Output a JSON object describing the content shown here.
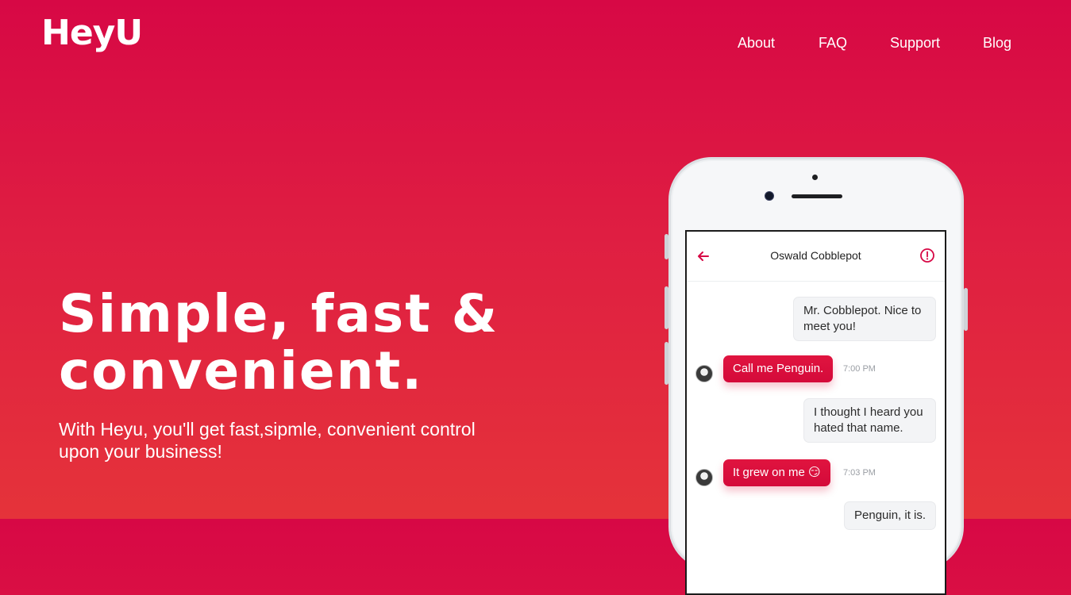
{
  "brand": {
    "logo": "HeyU"
  },
  "nav": {
    "items": [
      {
        "label": "About"
      },
      {
        "label": "FAQ"
      },
      {
        "label": "Support"
      },
      {
        "label": "Blog"
      }
    ]
  },
  "hero": {
    "title_line1": "Simple, fast &",
    "title_line2": "convenient.",
    "subtitle": "With Heyu, you'll get fast,sipmle, convenient control upon your business!"
  },
  "chat": {
    "contact_name": "Oswald Cobblepot",
    "messages": [
      {
        "from": "me",
        "text": "Mr. Cobblepot. Nice to meet you!"
      },
      {
        "from": "contact",
        "text": "Call me Penguin.",
        "time": "7:00 PM"
      },
      {
        "from": "me",
        "text": "I thought I heard you hated that name."
      },
      {
        "from": "contact",
        "text": "It grew on me 😏",
        "time": "7:03 PM"
      },
      {
        "from": "me",
        "text": "Penguin, it is."
      }
    ]
  },
  "colors": {
    "accent": "#d70845",
    "accent_bottom": "#e5333a",
    "bubble_in": "#e0143f",
    "bubble_out": "#f3f4f6"
  }
}
